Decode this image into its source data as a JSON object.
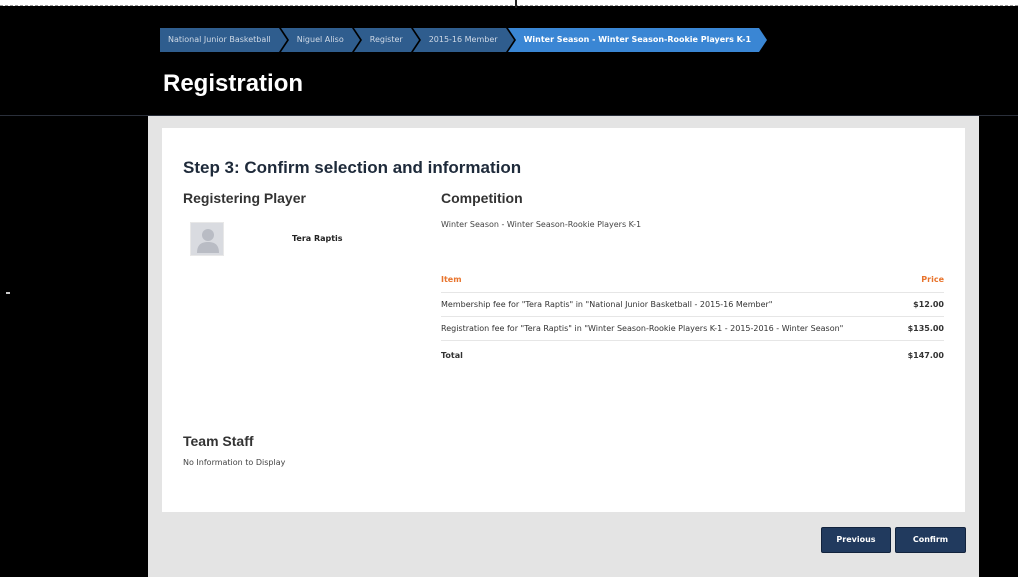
{
  "breadcrumb": [
    {
      "label": "National Junior Basketball",
      "active": false
    },
    {
      "label": "Niguel Aliso",
      "active": false
    },
    {
      "label": "Register",
      "active": false
    },
    {
      "label": "2015-16 Member",
      "active": false
    },
    {
      "label": "Winter Season - Winter Season-Rookie Players K-1",
      "active": true
    }
  ],
  "page_title": "Registration",
  "step_title": "Step 3: Confirm selection and information",
  "player": {
    "heading": "Registering Player",
    "name": "Tera Raptis",
    "avatar_icon": "user-silhouette-icon"
  },
  "competition": {
    "heading": "Competition",
    "name": "Winter Season - Winter Season-Rookie Players K-1",
    "table": {
      "headers": {
        "item": "Item",
        "price": "Price"
      },
      "rows": [
        {
          "item": "Membership fee for \"Tera Raptis\" in \"National Junior Basketball - 2015-16 Member\"",
          "price": "$12.00"
        },
        {
          "item": "Registration fee for \"Tera Raptis\" in \"Winter Season-Rookie Players K-1 - 2015-2016 - Winter Season\"",
          "price": "$135.00"
        }
      ],
      "total": {
        "label": "Total",
        "price": "$147.00"
      }
    }
  },
  "team_staff": {
    "heading": "Team Staff",
    "message": "No Information to Display"
  },
  "buttons": {
    "previous": "Previous",
    "confirm": "Confirm"
  },
  "colors": {
    "background": "#000000",
    "breadcrumb": "#2f5d8e",
    "breadcrumb_active": "#3a86d4",
    "table_header": "#e8742d",
    "button": "#213a5e"
  }
}
